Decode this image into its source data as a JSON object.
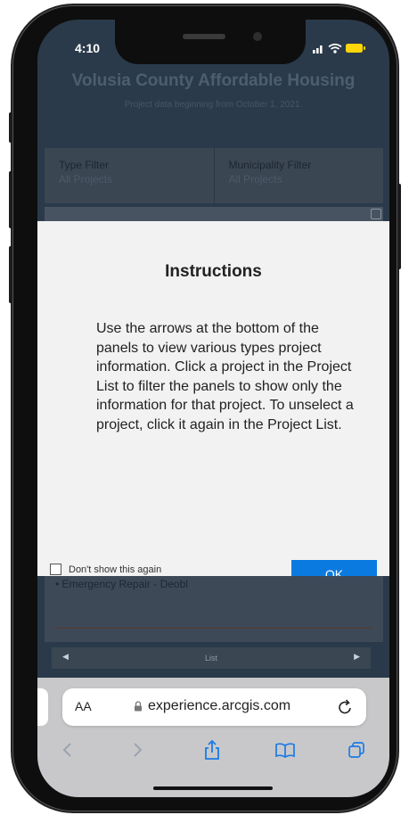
{
  "status_bar": {
    "time": "4:10"
  },
  "app": {
    "title": "Volusia County Affordable Housing",
    "subtitle": "Project data beginning from October 1, 2021."
  },
  "filters": [
    {
      "label": "Type Filter",
      "value": "All Projects"
    },
    {
      "label": "Municipality Filter",
      "value": "All Projects"
    }
  ],
  "modal": {
    "title": "Instructions",
    "body": "Use the arrows at the bottom of the panels to view various types project information. Click a project in the Project List to filter the panels to show only the information for that project. To unselect a project, click it again in the Project List.",
    "checkbox_label": "Don't show this again",
    "ok_label": "OK"
  },
  "list": {
    "partial_item": "• Emergency Repair - Deobl",
    "nav_label": "List"
  },
  "browser": {
    "aa_label": "AA",
    "url": "experience.arcgis.com"
  },
  "colors": {
    "app_background": "#2a3a4a",
    "ok_button": "#0a7ae0",
    "modal_background": "#f2f2f2",
    "browser_chrome": "#c8c8ca",
    "toolbar_icon_active": "#1a7ae6",
    "toolbar_icon_disabled": "#9aa4b0"
  },
  "icons": {
    "status": [
      "signal-icon",
      "wifi-icon",
      "battery-icon"
    ],
    "toolbar": [
      "back-icon",
      "forward-icon",
      "share-icon",
      "bookmarks-icon",
      "tabs-icon"
    ]
  }
}
